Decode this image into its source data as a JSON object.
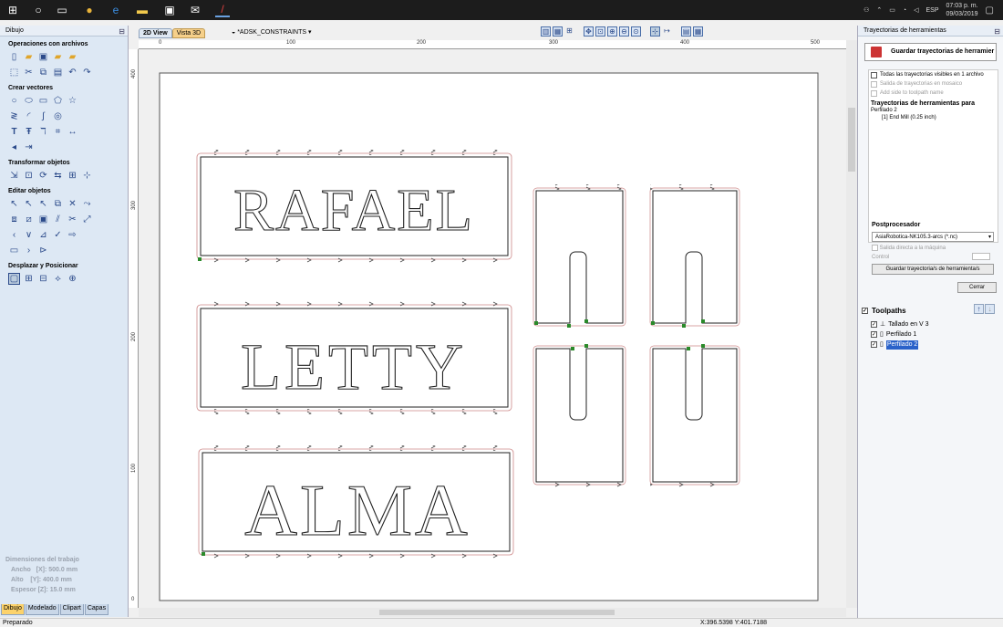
{
  "taskbar": {
    "time": "07:03 p. m.",
    "date": "09/03/2019",
    "language": "ESP"
  },
  "left_panel": {
    "title": "Dibujo",
    "sections": [
      {
        "title": "Operaciones con archivos"
      },
      {
        "title": "Crear vectores"
      },
      {
        "title": "Transformar objetos"
      },
      {
        "title": "Editar objetos"
      },
      {
        "title": "Desplazar y Posicionar"
      }
    ],
    "dimensions": {
      "title": "Dimensiones del trabajo",
      "width": "Ancho   [X]: 500.0 mm",
      "height": "Alto    [Y]: 400.0 mm",
      "thickness": "Espesor [Z]: 15.0 mm"
    },
    "tabs": [
      "Dibujo",
      "Modelado",
      "Clipart",
      "Capas"
    ]
  },
  "view": {
    "tab_2d": "2D View",
    "tab_3d": "Vista 3D",
    "document": "*ADSK_CONSTRAINTS",
    "ruler_top": [
      "0",
      "100",
      "200",
      "300",
      "400",
      "500"
    ],
    "ruler_left": [
      "400",
      "300",
      "200",
      "100",
      "0"
    ],
    "words": [
      "RAFAEL",
      "LETTY",
      "ALMA"
    ]
  },
  "right_panel": {
    "title": "Trayectorias de herramientas",
    "save_button": "Guardar trayectorias de herramier",
    "opt_visible": "Todas las trayectorias visibles en 1 archivo",
    "opt_mosaic": "Salida de trayectorias en mosaico",
    "opt_side": "Add side to toolpath name",
    "toolpaths_for": "Trayectorias de herramientas para",
    "toolpath_name": "Perfilado 2",
    "tool": "[1] End Mill (0.25 inch)",
    "postprocessor_title": "Postprocesador",
    "postprocessor": "AsiaRobotica-NK105.3-arcs (*.nc)",
    "direct_output": "Salida directa a la máquina",
    "control": "Control",
    "save_paths": "Guardar trayectoria/s de herramienta/s",
    "close": "Cerrar",
    "toolpaths_header": "Toolpaths",
    "toolpaths": [
      "Tallado en V 3",
      "Perfilado 1",
      "Perfilado 2"
    ]
  },
  "status": {
    "text": "Preparado",
    "coords": "X:396.5398 Y:401.7188"
  }
}
